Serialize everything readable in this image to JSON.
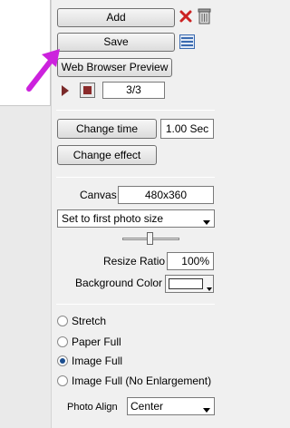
{
  "buttons": {
    "add": "Add",
    "save": "Save",
    "web_preview": "Web Browser Preview",
    "change_time": "Change time",
    "change_effect": "Change effect"
  },
  "player": {
    "counter": "3/3"
  },
  "time_value": "1.00 Sec",
  "canvas": {
    "label": "Canvas",
    "value": "480x360",
    "size_option": "Set to first photo size"
  },
  "resize": {
    "label": "Resize Ratio",
    "value": "100%",
    "slider_level": 0.48
  },
  "background_color": {
    "label": "Background Color",
    "color": "#ffffff"
  },
  "fit_options": [
    {
      "label": "Stretch",
      "selected": false
    },
    {
      "label": "Paper Full",
      "selected": false
    },
    {
      "label": "Image Full",
      "selected": true
    },
    {
      "label": "Image Full (No Enlargement)",
      "selected": false
    }
  ],
  "photo_align": {
    "label": "Photo Align",
    "value": "Center"
  },
  "colors": {
    "accent_arrow": "#cc22dd",
    "delete_x": "#cc2222"
  },
  "icons": [
    "delete-x-icon",
    "trash-can-icon",
    "list-view-icon",
    "play-icon",
    "stop-icon",
    "dropdown-arrow-icon",
    "pointer-arrow-icon"
  ]
}
